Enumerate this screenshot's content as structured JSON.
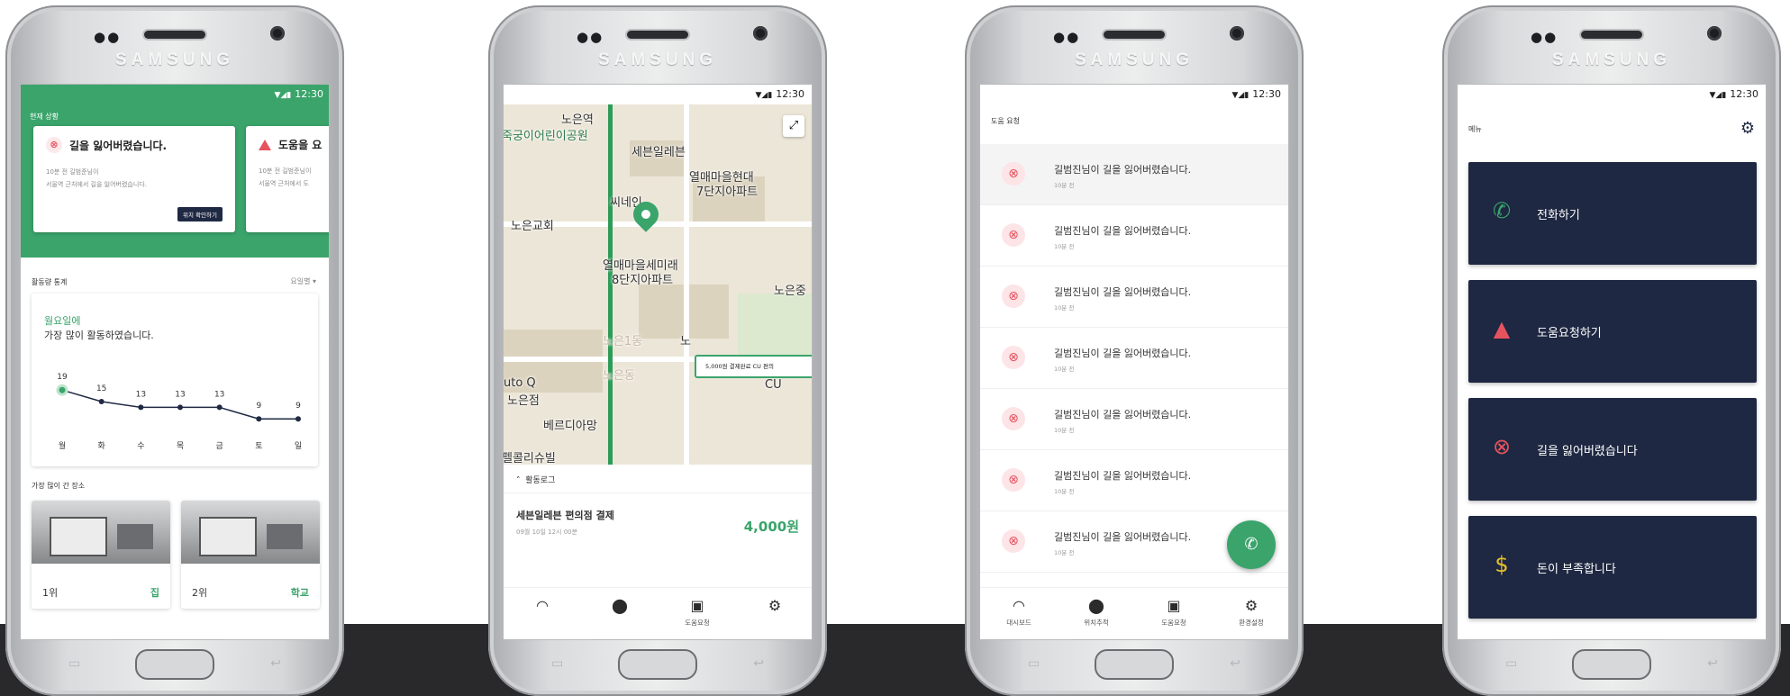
{
  "brand": "SAMSUNG",
  "status_time": "12:30",
  "status_signal": "▼◢▮",
  "phone1": {
    "current_status_title": "현재 상황",
    "alert_card": {
      "title": "길을 잃어버렸습니다.",
      "body_line1": "10분 전 길범준님이",
      "body_line2": "서울역 근처에서 길을 잃어버렸습니다.",
      "button": "위치 확인하기"
    },
    "second_card": {
      "title": "도움을 요",
      "body_line1": "10분 전 길범준님이",
      "body_line2": "서울역 근처에서 도"
    },
    "activity_stats_title": "활동량 통계",
    "period_select": "요일별 ▾",
    "highlight_day": "월요일에",
    "highlight_desc": "가장 많이 활동하였습니다.",
    "most_visited_title": "가장 많이 간 장소",
    "places": [
      {
        "rank": "1위",
        "name": "집"
      },
      {
        "rank": "2위",
        "name": "학교"
      }
    ]
  },
  "chart_data": {
    "type": "line",
    "categories": [
      "월",
      "화",
      "수",
      "목",
      "금",
      "토",
      "일"
    ],
    "values": [
      19,
      15,
      13,
      13,
      13,
      9,
      9
    ],
    "title": "",
    "xlabel": "",
    "ylabel": "",
    "ylim": [
      0,
      25
    ],
    "grid": false,
    "highlight_index": 0,
    "colors": {
      "line": "#1f2943",
      "highlight": "#3aa46b"
    }
  },
  "phone2": {
    "map_labels": {
      "station": "노은역",
      "park": "죽궁이어린이공원",
      "store": "세븐일레븐",
      "apt1_line1": "열매마을현대",
      "apt1_line2": "7단지아파트",
      "cafe": "씨네인",
      "church": "노은교회",
      "apt2_line1": "열매마을세미래",
      "apt2_line2": "8단지아파트",
      "right_place": "노은중",
      "dong1": "노은1동",
      "dong_short": "노",
      "dong2": "노은동",
      "auto": "uto Q",
      "noeun": "노은점",
      "bakery": "베르디아망",
      "villa": "펠콜리슈빌",
      "cu": "CU",
      "bubble": "5,000원 결제완료 CU 편의",
      "expand_icon": "⤢"
    },
    "activity_log_label": "활동로그",
    "log_title": "세븐일레븐 편의점 결제",
    "log_date": "09월 10일 12시 00분",
    "log_amount": "4,000원",
    "tabs": [
      {
        "icon": "◠",
        "label": ""
      },
      {
        "icon": "⬤",
        "label": ""
      },
      {
        "icon": "▣",
        "label": "도움요청"
      },
      {
        "icon": "⚙",
        "label": ""
      }
    ]
  },
  "phone3": {
    "title": "도움 요청",
    "request_title": "길범진님이 길을 잃어버렸습니다.",
    "request_time": "10분 전",
    "fab_icon": "✆",
    "tabs": [
      {
        "icon": "◠",
        "label": "대시보드"
      },
      {
        "icon": "⬤",
        "label": "위치추적"
      },
      {
        "icon": "▣",
        "label": "도움요청"
      },
      {
        "icon": "⚙",
        "label": "환경설정"
      }
    ]
  },
  "phone4": {
    "title": "메뉴",
    "gear_icon": "⚙",
    "menu": [
      {
        "icon": "✆",
        "label": "전화하기",
        "color": "#3aa46b"
      },
      {
        "icon": "▲",
        "label": "도움요청하기",
        "color": "#e5535f"
      },
      {
        "icon": "⊗",
        "label": "길을 잃어버렸습니다",
        "color": "#e5535f"
      },
      {
        "icon": "$",
        "label": "돈이 부족합니다",
        "color": "#e8c12a"
      }
    ]
  }
}
